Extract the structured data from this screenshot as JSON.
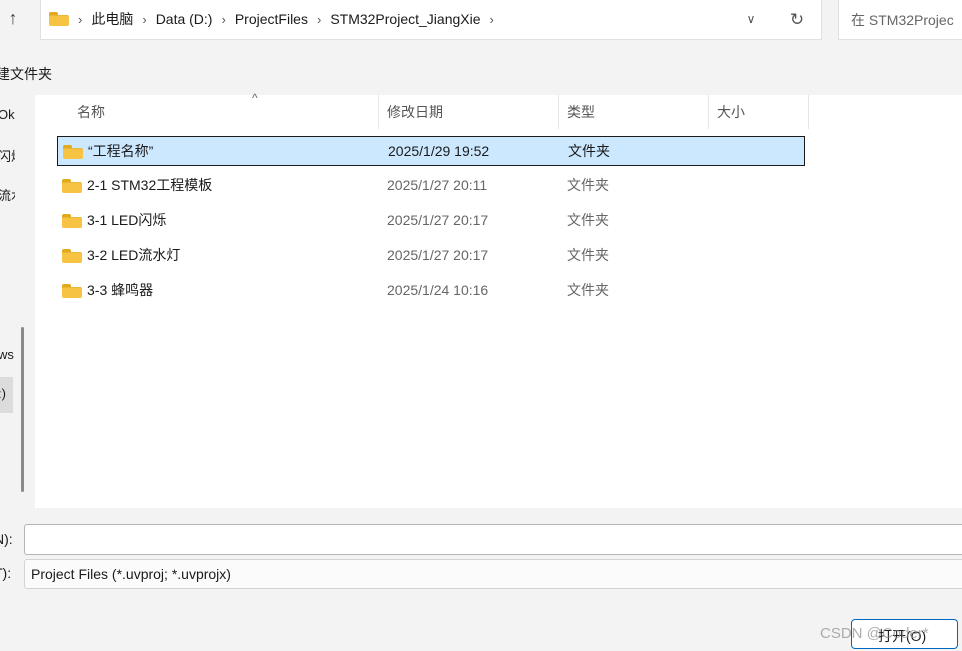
{
  "toolbar": {
    "address_crumbs": [
      "此电脑",
      "Data (D:)",
      "ProjectFiles",
      "STM32Project_JiangXie"
    ],
    "search_placeholder": "在 STM32Projec",
    "new_folder_label": "建文件夹"
  },
  "icons": {
    "up": "arrow-up-icon",
    "folder": "folder-icon",
    "breadcrumb_separator": "chevron-right-icon",
    "history_dropdown": "chevron-down-icon",
    "refresh": "refresh-icon",
    "sort": "sort-ascending-icon"
  },
  "navigation": {
    "fragments": [
      "Ok",
      "闪烁",
      "流水",
      "ws",
      ":)"
    ]
  },
  "columns": {
    "name": "名称",
    "date": "修改日期",
    "type": "类型",
    "size": "大小"
  },
  "files": [
    {
      "name": "“工程名称”",
      "date": "2025/1/29 19:52",
      "type": "文件夹",
      "selected": true
    },
    {
      "name": "2-1 STM32工程模板",
      "date": "2025/1/27 20:11",
      "type": "文件夹",
      "selected": false
    },
    {
      "name": "3-1 LED闪烁",
      "date": "2025/1/27 20:17",
      "type": "文件夹",
      "selected": false
    },
    {
      "name": "3-2 LED流水灯",
      "date": "2025/1/27 20:17",
      "type": "文件夹",
      "selected": false
    },
    {
      "name": "3-3 蜂鸣器",
      "date": "2025/1/24 10:16",
      "type": "文件夹",
      "selected": false
    }
  ],
  "footer": {
    "filename_label": "N):",
    "filename_value": "",
    "filetype_label": "T):",
    "filetype_value": "Project Files (*.uvproj; *.uvprojx)",
    "open_button": "打开(O)"
  },
  "watermark": "CSDN @Coder*",
  "colors": {
    "selection": "#cce8ff",
    "folder": "#f6c342",
    "accent": "#0067c0"
  }
}
